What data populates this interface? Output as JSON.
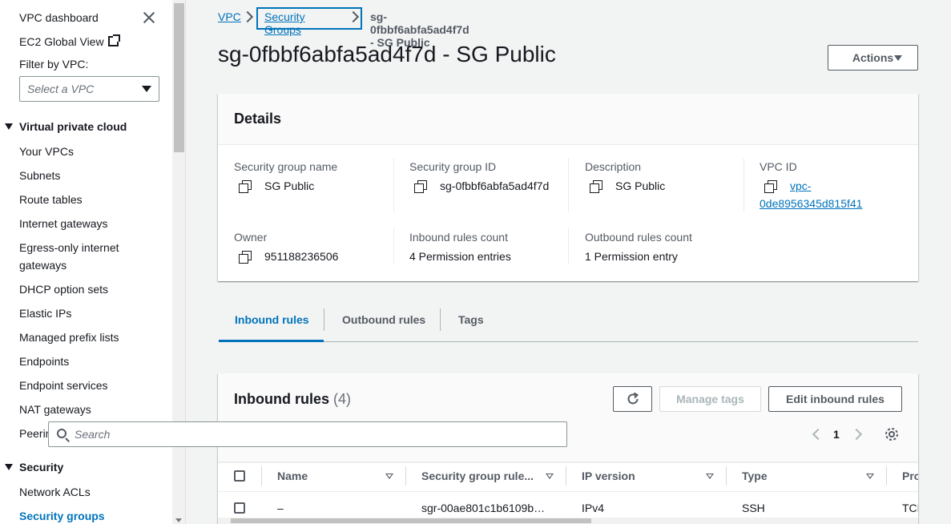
{
  "sidebar": {
    "title": "VPC dashboard",
    "ec2_global_view": "EC2 Global View",
    "filter_label": "Filter by VPC:",
    "filter_placeholder": "Select a VPC",
    "section_vpc": "Virtual private cloud",
    "vpc_items": [
      "Your VPCs",
      "Subnets",
      "Route tables",
      "Internet gateways",
      "Egress-only internet",
      "gateways",
      "DHCP option sets",
      "Elastic IPs",
      "Managed prefix lists",
      "Endpoints",
      "Endpoint services",
      "NAT gateways",
      "Peering connections"
    ],
    "section_security": "Security",
    "security_items": [
      "Network ACLs",
      "Security groups"
    ]
  },
  "breadcrumb": {
    "root": "VPC",
    "parent": "Security Groups",
    "current": "sg-0fbbf6abfa5ad4f7d - SG Public"
  },
  "page": {
    "title": "sg-0fbbf6abfa5ad4f7d - SG Public",
    "actions_label": "Actions"
  },
  "details": {
    "heading": "Details",
    "sg_name_label": "Security group name",
    "sg_name": "SG Public",
    "sg_id_label": "Security group ID",
    "sg_id": "sg-0fbbf6abfa5ad4f7d",
    "description_label": "Description",
    "description": "SG Public",
    "vpc_id_label": "VPC ID",
    "vpc_id_line1": "vpc-",
    "vpc_id_line2": "0de8956345d815f41",
    "owner_label": "Owner",
    "owner": "951188236506",
    "inbound_count_label": "Inbound rules count",
    "inbound_count": "4 Permission entries",
    "outbound_count_label": "Outbound rules count",
    "outbound_count": "1 Permission entry"
  },
  "tabs": [
    "Inbound rules",
    "Outbound rules",
    "Tags"
  ],
  "inbound": {
    "heading": "Inbound rules",
    "count": "(4)",
    "manage_tags": "Manage tags",
    "edit_rules": "Edit inbound rules",
    "search_placeholder": "Search",
    "page_number": "1",
    "columns": [
      "Name",
      "Security group rule...",
      "IP version",
      "Type",
      "Pro"
    ],
    "rows": [
      {
        "name": "–",
        "rule_id": "sgr-00ae801c1b6109b…",
        "ip_version": "IPv4",
        "type": "SSH",
        "protocol": "TCP"
      }
    ]
  },
  "colors": {
    "link": "#0073bb",
    "text": "#16191f",
    "muted": "#545b64",
    "background": "#f2f3f3"
  }
}
